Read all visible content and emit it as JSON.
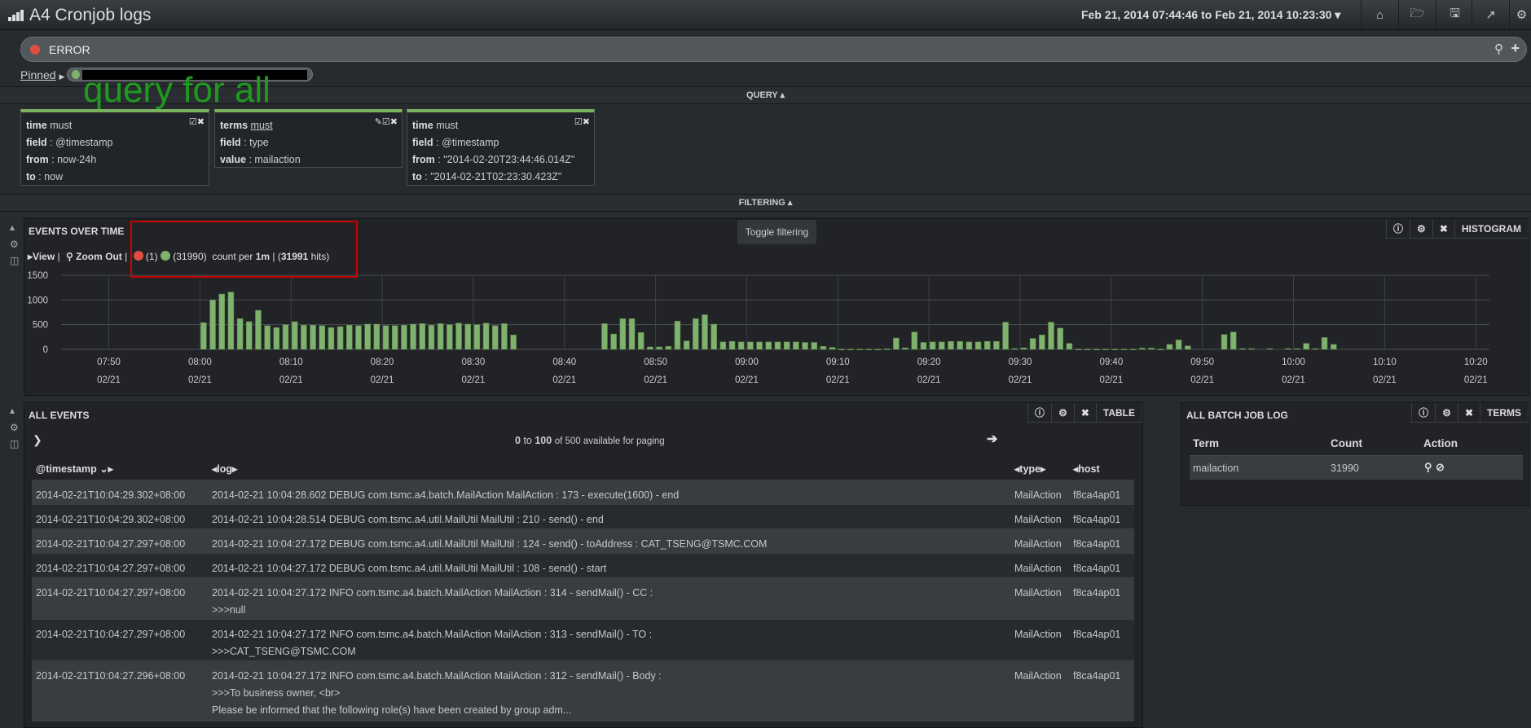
{
  "app": {
    "title": "A4 Cronjob logs",
    "logo_icon": "bar-chart-icon"
  },
  "nav": {
    "time_range": "Feb 21, 2014 07:44:46 to Feb 21, 2014 10:23:30",
    "buttons": [
      "home-icon",
      "folder-open-icon",
      "save-icon",
      "share-icon",
      "gear-icon"
    ]
  },
  "query": {
    "value": "ERROR",
    "color": "#e24d42"
  },
  "pinned": {
    "label": "Pinned",
    "color": "#7eb26d"
  },
  "annotation": "query for all",
  "sections": {
    "query": "QUERY",
    "filtering": "FILTERING"
  },
  "filters": [
    {
      "type": "time",
      "mode": "must",
      "rows": [
        [
          "field",
          "@timestamp"
        ],
        [
          "from",
          "now-24h"
        ],
        [
          "to",
          "now"
        ]
      ]
    },
    {
      "type": "terms",
      "mode": "must",
      "rows": [
        [
          "field",
          "type"
        ],
        [
          "value",
          "mailaction"
        ]
      ]
    },
    {
      "type": "time",
      "mode": "must",
      "rows": [
        [
          "field",
          "@timestamp"
        ],
        [
          "from",
          "\"2014-02-20T23:44:46.014Z\""
        ],
        [
          "to",
          "\"2014-02-21T02:23:30.423Z\""
        ]
      ]
    }
  ],
  "histogram": {
    "title": "EVENTS OVER TIME",
    "panel_type": "HISTOGRAM",
    "tooltip": "Toggle filtering",
    "view": "View",
    "zoom_out": "Zoom Out",
    "legend": [
      {
        "count": "(1)",
        "color": "#e24d42"
      },
      {
        "count": "(31990)",
        "color": "#7eb26d"
      }
    ],
    "count_per": "count per",
    "interval": "1m",
    "hits_open": "(",
    "hits": "31991",
    "hits_close": "hits)"
  },
  "chart_data": {
    "type": "bar",
    "xlabel": "",
    "ylabel": "",
    "ylim": [
      0,
      1500
    ],
    "yticks": [
      0,
      500,
      1000,
      1500
    ],
    "xrange": [
      "07:44:46",
      "10:21:30"
    ],
    "xticks": [
      "07:50",
      "08:00",
      "08:10",
      "08:20",
      "08:30",
      "08:40",
      "08:50",
      "09:00",
      "09:10",
      "09:20",
      "09:30",
      "09:40",
      "09:50",
      "10:00",
      "10:10",
      "10:20"
    ],
    "xtick_date": "02/21",
    "grid": true,
    "color": "#7eb26d",
    "points": [
      [
        "08:00",
        540
      ],
      [
        "08:01",
        1000
      ],
      [
        "08:02",
        1120
      ],
      [
        "08:03",
        1160
      ],
      [
        "08:04",
        620
      ],
      [
        "08:05",
        560
      ],
      [
        "08:06",
        790
      ],
      [
        "08:07",
        480
      ],
      [
        "08:08",
        440
      ],
      [
        "08:09",
        500
      ],
      [
        "08:10",
        560
      ],
      [
        "08:11",
        490
      ],
      [
        "08:12",
        490
      ],
      [
        "08:13",
        480
      ],
      [
        "08:14",
        440
      ],
      [
        "08:15",
        460
      ],
      [
        "08:16",
        490
      ],
      [
        "08:17",
        480
      ],
      [
        "08:18",
        510
      ],
      [
        "08:19",
        510
      ],
      [
        "08:20",
        480
      ],
      [
        "08:21",
        480
      ],
      [
        "08:22",
        490
      ],
      [
        "08:23",
        510
      ],
      [
        "08:24",
        520
      ],
      [
        "08:25",
        490
      ],
      [
        "08:26",
        520
      ],
      [
        "08:27",
        500
      ],
      [
        "08:28",
        530
      ],
      [
        "08:29",
        510
      ],
      [
        "08:30",
        500
      ],
      [
        "08:31",
        530
      ],
      [
        "08:32",
        480
      ],
      [
        "08:33",
        520
      ],
      [
        "08:34",
        290
      ],
      [
        "08:44",
        520
      ],
      [
        "08:45",
        310
      ],
      [
        "08:46",
        620
      ],
      [
        "08:47",
        620
      ],
      [
        "08:48",
        340
      ],
      [
        "08:49",
        50
      ],
      [
        "08:50",
        50
      ],
      [
        "08:51",
        60
      ],
      [
        "08:52",
        570
      ],
      [
        "08:53",
        170
      ],
      [
        "08:54",
        620
      ],
      [
        "08:55",
        700
      ],
      [
        "08:56",
        510
      ],
      [
        "08:57",
        150
      ],
      [
        "08:58",
        160
      ],
      [
        "08:59",
        150
      ],
      [
        "09:00",
        150
      ],
      [
        "09:01",
        150
      ],
      [
        "09:02",
        150
      ],
      [
        "09:03",
        150
      ],
      [
        "09:04",
        150
      ],
      [
        "09:05",
        150
      ],
      [
        "09:06",
        140
      ],
      [
        "09:07",
        140
      ],
      [
        "09:08",
        60
      ],
      [
        "09:09",
        40
      ],
      [
        "09:10",
        5
      ],
      [
        "09:11",
        5
      ],
      [
        "09:12",
        5
      ],
      [
        "09:13",
        5
      ],
      [
        "09:14",
        5
      ],
      [
        "09:15",
        10
      ],
      [
        "09:16",
        230
      ],
      [
        "09:17",
        30
      ],
      [
        "09:18",
        350
      ],
      [
        "09:19",
        140
      ],
      [
        "09:20",
        150
      ],
      [
        "09:21",
        150
      ],
      [
        "09:22",
        160
      ],
      [
        "09:23",
        160
      ],
      [
        "09:24",
        150
      ],
      [
        "09:25",
        150
      ],
      [
        "09:26",
        160
      ],
      [
        "09:27",
        160
      ],
      [
        "09:28",
        550
      ],
      [
        "09:29",
        15
      ],
      [
        "09:30",
        30
      ],
      [
        "09:31",
        220
      ],
      [
        "09:32",
        290
      ],
      [
        "09:33",
        550
      ],
      [
        "09:34",
        430
      ],
      [
        "09:35",
        120
      ],
      [
        "09:36",
        5
      ],
      [
        "09:37",
        5
      ],
      [
        "09:38",
        5
      ],
      [
        "09:39",
        5
      ],
      [
        "09:40",
        5
      ],
      [
        "09:41",
        5
      ],
      [
        "09:42",
        5
      ],
      [
        "09:43",
        25
      ],
      [
        "09:44",
        25
      ],
      [
        "09:45",
        5
      ],
      [
        "09:46",
        100
      ],
      [
        "09:47",
        190
      ],
      [
        "09:48",
        70
      ],
      [
        "09:52",
        300
      ],
      [
        "09:53",
        350
      ],
      [
        "09:54",
        15
      ],
      [
        "09:55",
        15
      ],
      [
        "09:57",
        15
      ],
      [
        "09:59",
        15
      ],
      [
        "10:00",
        15
      ],
      [
        "10:01",
        120
      ],
      [
        "10:02",
        15
      ],
      [
        "10:03",
        240
      ],
      [
        "10:04",
        100
      ]
    ]
  },
  "table": {
    "title": "ALL EVENTS",
    "panel_type": "TABLE",
    "paging": {
      "from": "0",
      "to_word": "to",
      "to": "100",
      "rest": "of 500 available for paging"
    },
    "columns": [
      "@timestamp",
      "log",
      "type",
      "host"
    ],
    "rows": [
      {
        "ts": "2014-02-21T10:04:29.302+08:00",
        "log": [
          "2014-02-21 10:04:28.602 DEBUG com.tsmc.a4.batch.MailAction MailAction : 173 - execute(1600) - end"
        ],
        "type": "MailAction",
        "host": "f8ca4ap01"
      },
      {
        "ts": "2014-02-21T10:04:29.302+08:00",
        "log": [
          "2014-02-21 10:04:28.514 DEBUG com.tsmc.a4.util.MailUtil MailUtil : 210 - send() - end"
        ],
        "type": "MailAction",
        "host": "f8ca4ap01"
      },
      {
        "ts": "2014-02-21T10:04:27.297+08:00",
        "log": [
          "2014-02-21 10:04:27.172 DEBUG com.tsmc.a4.util.MailUtil MailUtil : 124 - send() - toAddress : CAT_TSENG@TSMC.COM"
        ],
        "type": "MailAction",
        "host": "f8ca4ap01"
      },
      {
        "ts": "2014-02-21T10:04:27.297+08:00",
        "log": [
          "2014-02-21 10:04:27.172 DEBUG com.tsmc.a4.util.MailUtil MailUtil : 108 - send() - start"
        ],
        "type": "MailAction",
        "host": "f8ca4ap01"
      },
      {
        "ts": "2014-02-21T10:04:27.297+08:00",
        "log": [
          "2014-02-21 10:04:27.172 INFO com.tsmc.a4.batch.MailAction MailAction : 314 - sendMail() - CC :",
          ">>>null"
        ],
        "type": "MailAction",
        "host": "f8ca4ap01"
      },
      {
        "ts": "2014-02-21T10:04:27.297+08:00",
        "log": [
          "2014-02-21 10:04:27.172 INFO com.tsmc.a4.batch.MailAction MailAction : 313 - sendMail() - TO :",
          ">>>CAT_TSENG@TSMC.COM"
        ],
        "type": "MailAction",
        "host": "f8ca4ap01"
      },
      {
        "ts": "2014-02-21T10:04:27.296+08:00",
        "log": [
          "2014-02-21 10:04:27.172 INFO com.tsmc.a4.batch.MailAction MailAction : 312 - sendMail() - Body :",
          ">>>To business owner, <br>",
          "Please be informed that the following role(s) have been created by group adm..."
        ],
        "type": "MailAction",
        "host": "f8ca4ap01"
      }
    ]
  },
  "terms": {
    "title": "ALL BATCH JOB LOG",
    "panel_type": "TERMS",
    "columns": [
      "Term",
      "Count",
      "Action"
    ],
    "rows": [
      {
        "term": "mailaction",
        "count": "31990"
      }
    ]
  }
}
